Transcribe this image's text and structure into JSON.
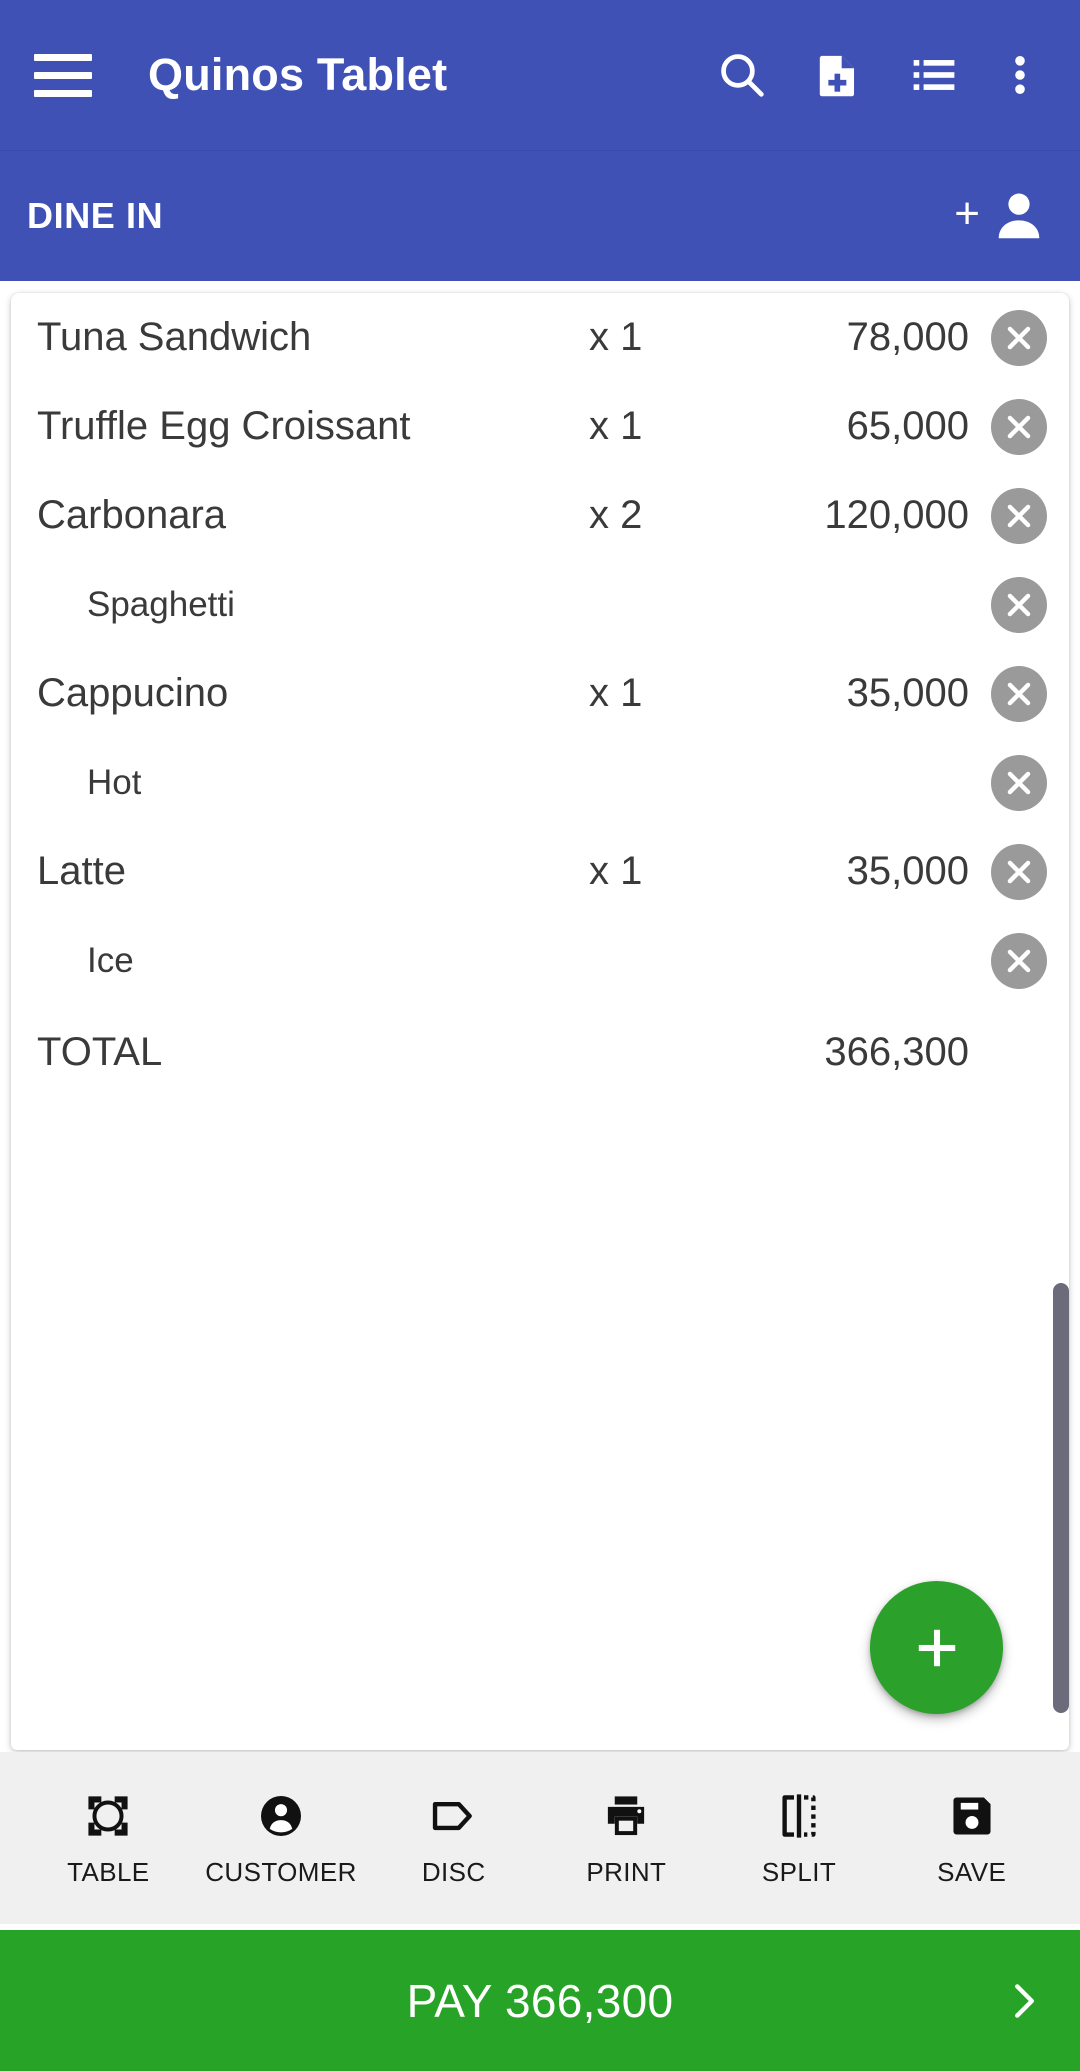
{
  "appbar": {
    "title": "Quinos Tablet",
    "menu_icon": "hamburger-menu-icon",
    "actions": [
      {
        "name": "search-icon",
        "label": "Search"
      },
      {
        "name": "new-document-icon",
        "label": "New Order"
      },
      {
        "name": "list-icon",
        "label": "Order List"
      },
      {
        "name": "overflow-menu-icon",
        "label": "More options"
      }
    ]
  },
  "order_type_bar": {
    "label": "DINE IN",
    "add_customer_plus": "+",
    "add_customer_icon": "person-icon"
  },
  "order": {
    "rows": [
      {
        "name": "Tuna Sandwich",
        "qty": "x 1",
        "price": "78,000",
        "type": "item"
      },
      {
        "name": "Truffle Egg Croissant",
        "qty": "x 1",
        "price": "65,000",
        "type": "item"
      },
      {
        "name": "Carbonara",
        "qty": "x 2",
        "price": "120,000",
        "type": "item"
      },
      {
        "name": "Spaghetti",
        "qty": "",
        "price": "",
        "type": "modifier"
      },
      {
        "name": "Cappucino",
        "qty": "x 1",
        "price": "35,000",
        "type": "item"
      },
      {
        "name": "Hot",
        "qty": "",
        "price": "",
        "type": "modifier"
      },
      {
        "name": "Latte",
        "qty": "x 1",
        "price": "35,000",
        "type": "item"
      },
      {
        "name": "Ice",
        "qty": "",
        "price": "",
        "type": "modifier"
      }
    ],
    "total_label": "TOTAL",
    "total_value": "366,300",
    "delete_icon": "close-circle-icon"
  },
  "fab": {
    "icon": "plus-icon",
    "label": "Add item"
  },
  "toolbar": {
    "items": [
      {
        "label": "TABLE",
        "icon": "table-frame-icon"
      },
      {
        "label": "CUSTOMER",
        "icon": "person-circle-icon"
      },
      {
        "label": "DISC",
        "icon": "tag-icon"
      },
      {
        "label": "PRINT",
        "icon": "printer-icon"
      },
      {
        "label": "SPLIT",
        "icon": "split-bill-icon"
      },
      {
        "label": "SAVE",
        "icon": "floppy-disk-icon"
      }
    ]
  },
  "paybar": {
    "label": "PAY 366,300",
    "chevron_icon": "chevron-right-icon"
  },
  "colors": {
    "primary_blue": "#3f51b5",
    "pay_green": "#27a327",
    "fab_green": "#2ba02b",
    "toolbar_bg": "#f0f0f0",
    "delete_gray": "#9a9a9a",
    "text_dark": "#3a3a3a",
    "scrollbar": "#6b6b7b"
  }
}
